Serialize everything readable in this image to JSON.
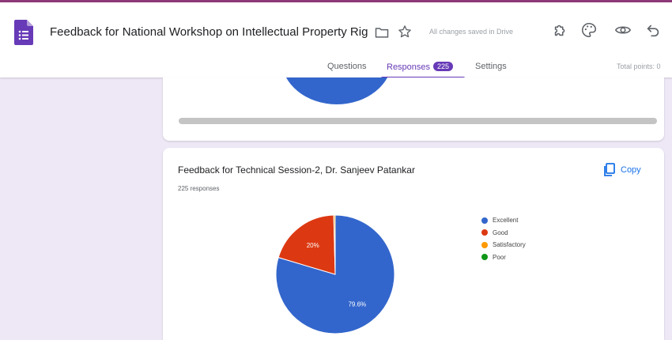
{
  "header": {
    "title": "Feedback  for National Workshop on Intellectual Property Rig",
    "save_status": "All changes saved in Drive"
  },
  "tabs": {
    "questions": "Questions",
    "responses": "Responses",
    "responses_count": "225",
    "settings": "Settings",
    "total_points": "Total points: 0"
  },
  "question": {
    "title": "Feedback for Technical Session-2, Dr. Sanjeev Patankar",
    "responses_text": "225 responses",
    "copy_label": "Copy"
  },
  "chart_data": {
    "type": "pie",
    "title": "Feedback for Technical Session-2, Dr. Sanjeev Patankar",
    "labels": [
      "Excellent",
      "Good",
      "Satisfactory",
      "Poor"
    ],
    "values": [
      79.6,
      20.0,
      0.4,
      0.0
    ],
    "slice_labels": [
      "79.6%",
      "20%",
      "",
      ""
    ],
    "colors": [
      "#3366cc",
      "#dc3912",
      "#ff9900",
      "#109618"
    ],
    "legend_position": "right"
  },
  "colors": {
    "accent": "#673ab7",
    "background": "#ede7f6",
    "link": "#1a73e8"
  }
}
